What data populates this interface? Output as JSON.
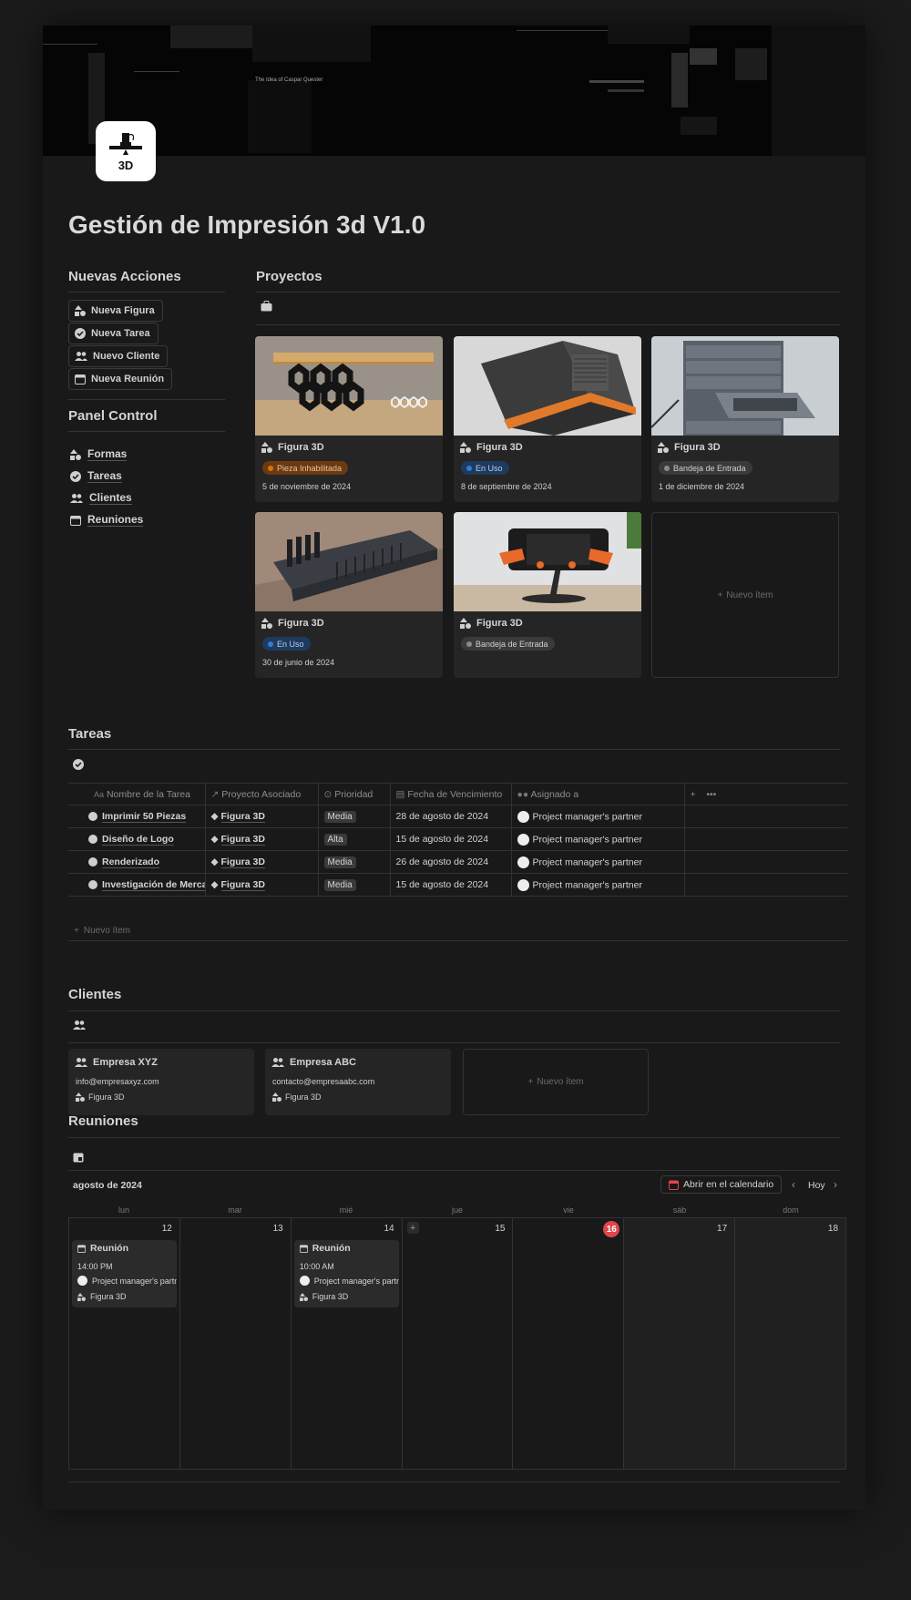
{
  "page": {
    "title": "Gestión de Impresión 3d V1.0",
    "icon": "3d-printer-icon",
    "icon_label": "3D"
  },
  "cover": {
    "text": "The Idea of Caspar Quester"
  },
  "acciones": {
    "heading": "Nuevas Acciones",
    "buttons": [
      {
        "label": "Nueva Figura",
        "icon": "shapes-icon"
      },
      {
        "label": "Nueva Tarea",
        "icon": "check-circle-icon"
      },
      {
        "label": "Nuevo Cliente",
        "icon": "people-icon"
      },
      {
        "label": "Nueva Reunión",
        "icon": "calendar-icon"
      }
    ]
  },
  "panel": {
    "heading": "Panel Control",
    "links": [
      {
        "label": "Formas",
        "icon": "shapes-icon"
      },
      {
        "label": "Tareas",
        "icon": "check-circle-icon"
      },
      {
        "label": "Clientes",
        "icon": "people-icon"
      },
      {
        "label": "Reuniones",
        "icon": "calendar-icon"
      }
    ]
  },
  "proyectos": {
    "heading": "Proyectos",
    "view_icon": "briefcase-icon",
    "new_item": "Nuevo ítem",
    "cards": [
      {
        "title": "Figura 3D",
        "status": "Pieza Inhabilitada",
        "status_color": "#d9730d",
        "status_bg": "#6b3a10",
        "date": "5 de noviembre de 2024",
        "image": "hexagon-monitor-stand"
      },
      {
        "title": "Figura 3D",
        "status": "En Uso",
        "status_color": "#2e7dd7",
        "status_bg": "#1f3a5f",
        "date": "8 de septiembre de 2024",
        "image": "desk-organizer"
      },
      {
        "title": "Figura 3D",
        "status": "Bandeja de Entrada",
        "status_color": "#8a8a8a",
        "status_bg": "#3a3a3a",
        "date": "1 de diciembre de 2024",
        "image": "drawer-cabinet"
      },
      {
        "title": "Figura 3D",
        "status": "En Uso",
        "status_color": "#2e7dd7",
        "status_bg": "#1f3a5f",
        "date": "30 de junio de 2024",
        "image": "card-holder"
      },
      {
        "title": "Figura 3D",
        "status": "Bandeja de Entrada",
        "status_color": "#8a8a8a",
        "status_bg": "#3a3a3a",
        "date": "",
        "image": "phone-stand"
      }
    ]
  },
  "tareas": {
    "heading": "Tareas",
    "view_icon": "check-circle-icon",
    "columns": [
      "Nombre de la Tarea",
      "Proyecto Asociado",
      "Prioridad",
      "Fecha de Vencimiento",
      "Asignado a"
    ],
    "rows": [
      {
        "name": "Imprimir 50 Piezas",
        "project": "Figura 3D",
        "priority": "Media",
        "due": "28 de agosto de 2024",
        "assignee": "Project manager's partner"
      },
      {
        "name": "Diseño de Logo",
        "project": "Figura 3D",
        "priority": "Alta",
        "due": "15 de agosto de 2024",
        "assignee": "Project manager's partner"
      },
      {
        "name": "Renderizado",
        "project": "Figura 3D",
        "priority": "Media",
        "due": "26 de agosto de 2024",
        "assignee": "Project manager's partner"
      },
      {
        "name": "Investigación de Mercado",
        "project": "Figura 3D",
        "priority": "Media",
        "due": "15 de agosto de 2024",
        "assignee": "Project manager's partner"
      }
    ],
    "new_item": "Nuevo ítem"
  },
  "clientes": {
    "heading": "Clientes",
    "view_icon": "people-icon",
    "cards": [
      {
        "name": "Empresa XYZ",
        "email": "info@empresaxyz.com",
        "project": "Figura 3D"
      },
      {
        "name": "Empresa ABC",
        "email": "contacto@empresaabc.com",
        "project": "Figura 3D"
      }
    ],
    "new_item": "Nuevo ítem"
  },
  "reuniones": {
    "heading": "Reuniones",
    "view_icon": "calendar-icon",
    "month": "agosto de 2024",
    "open_calendar": "Abrir en el calendario",
    "today_btn": "Hoy",
    "weekdays": [
      "lun",
      "mar",
      "mié",
      "jue",
      "vie",
      "sáb",
      "dom"
    ],
    "days": [
      "12",
      "13",
      "14",
      "15",
      "16",
      "17",
      "18"
    ],
    "today_index": 4,
    "events": [
      {
        "day_index": 0,
        "title": "Reunión",
        "time": "14:00 PM",
        "person": "Project manager's partner",
        "project": "Figura 3D"
      },
      {
        "day_index": 2,
        "title": "Reunión",
        "time": "10:00 AM",
        "person": "Project manager's partner",
        "project": "Figura 3D"
      }
    ]
  },
  "colors": {
    "page_bg": "#191919",
    "card_bg": "#252525",
    "today": "#e0454b",
    "calendar_red": "#e0454b"
  }
}
